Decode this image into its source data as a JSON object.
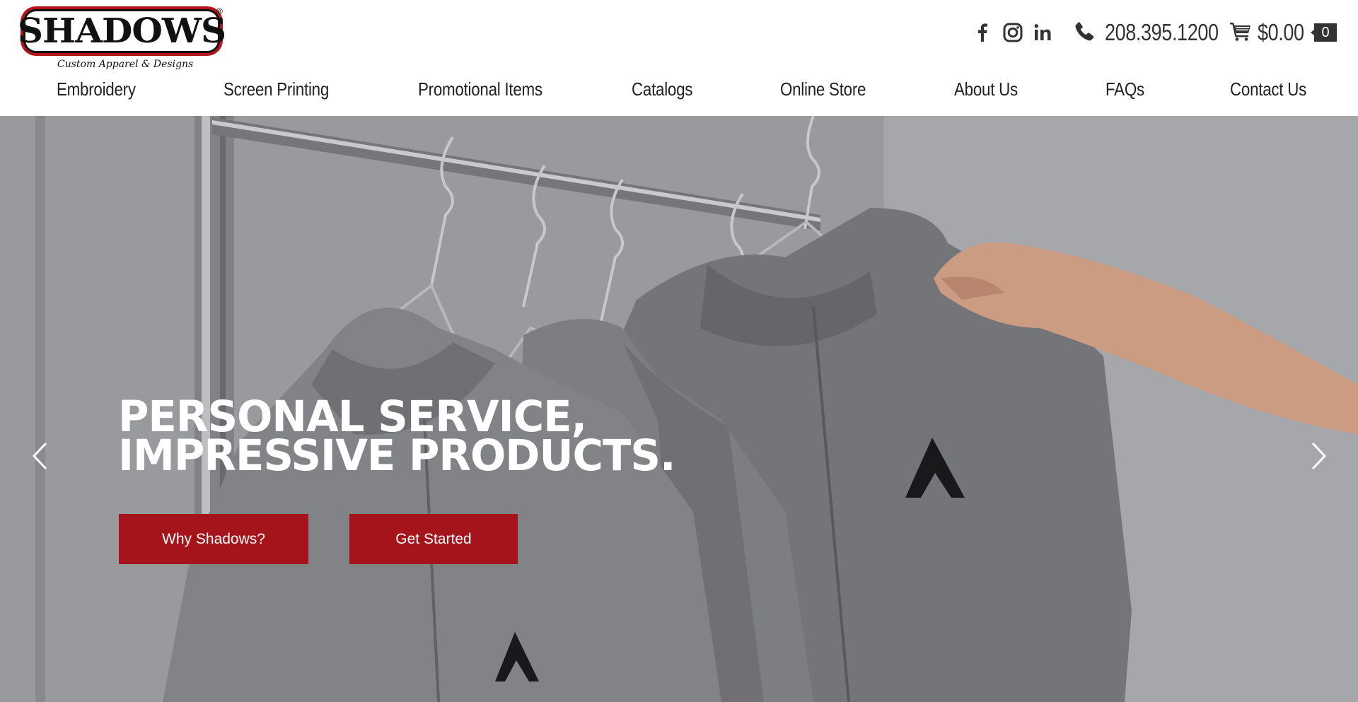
{
  "brand": {
    "name": "SHADOWS",
    "registered_mark": "®",
    "tagline": "Custom Apparel & Designs",
    "accent_color": "#a5141a"
  },
  "topbar": {
    "social": [
      {
        "name": "facebook-icon"
      },
      {
        "name": "instagram-icon"
      },
      {
        "name": "linkedin-icon"
      }
    ],
    "phone": "208.395.1200",
    "cart_total": "$0.00",
    "cart_count": "0"
  },
  "nav": {
    "items": [
      {
        "label": "Embroidery"
      },
      {
        "label": "Screen Printing"
      },
      {
        "label": "Promotional Items"
      },
      {
        "label": "Catalogs"
      },
      {
        "label": "Online Store"
      },
      {
        "label": "About Us"
      },
      {
        "label": "FAQs"
      },
      {
        "label": "Contact Us"
      }
    ]
  },
  "hero": {
    "headline_line1": "PERSONAL SERVICE,",
    "headline_line2": "IMPRESSIVE PRODUCTS.",
    "primary_button": "Why Shadows?",
    "secondary_button": "Get Started",
    "prev_icon": "chevron-left-icon",
    "next_icon": "chevron-right-icon"
  }
}
